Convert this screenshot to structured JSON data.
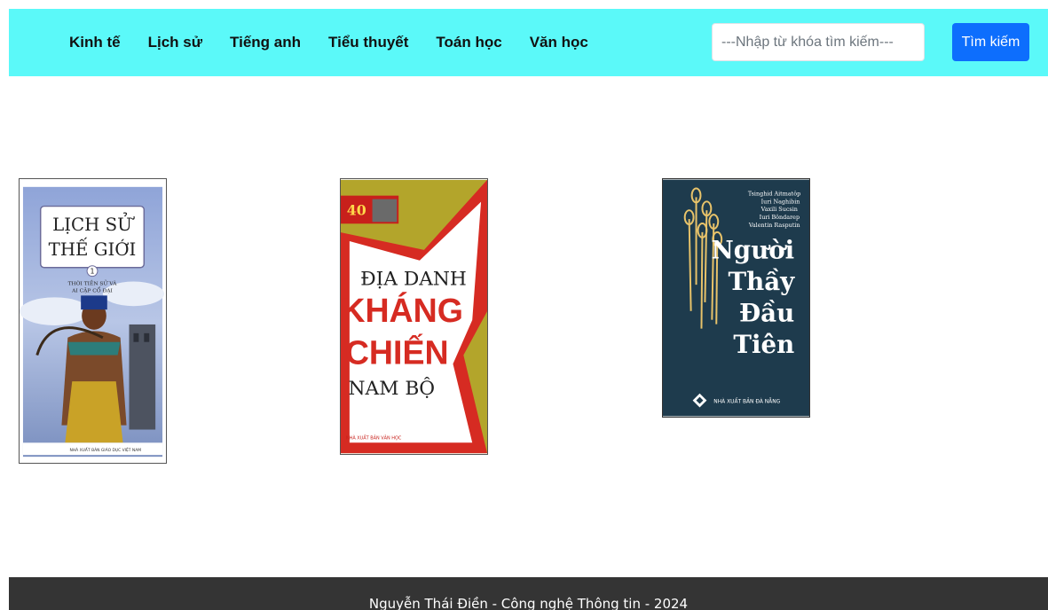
{
  "nav": {
    "links": [
      "Kinh tế",
      "Lịch sử",
      "Tiếng anh",
      "Tiểu thuyết",
      "Toán học",
      "Văn học"
    ]
  },
  "search": {
    "placeholder": "---Nhập từ khóa tìm kiếm---",
    "button_label": "Tìm kiếm"
  },
  "books": [
    {
      "title_lines": [
        "LỊCH SỬ",
        "THẾ GIỚI"
      ],
      "volume": "1",
      "subtitle_lines": [
        "THỜI TIỀN SỬ VÀ",
        "AI CẬP CỔ ĐẠI"
      ],
      "publisher": "NHÀ XUẤT BẢN GIÁO DỤC VIỆT NAM"
    },
    {
      "badge": "40",
      "title_lines": [
        "ĐỊA DANH",
        "KHÁNG",
        "CHIẾN",
        "NAM BỘ"
      ],
      "publisher": "NHÀ XUẤT BẢN VĂN HỌC"
    },
    {
      "authors": [
        "Tsinghid Aitmatôp",
        "Iuri Naghibin",
        "Vaxili Sucsin",
        "Iuri Bôndarep",
        "Valentin Rasputin"
      ],
      "title_lines": [
        "Người",
        "Thầy",
        "Đầu",
        "Tiên"
      ],
      "publisher": "NHÀ XUẤT BẢN ĐÀ NẴNG"
    }
  ],
  "colors": {
    "navbar_bg": "#5bf9f9",
    "button_bg": "#0d6efd",
    "footer_bg": "#343434"
  },
  "footer": {
    "text": "Nguyễn Thái Điền - Công nghệ Thông tin - 2024"
  }
}
